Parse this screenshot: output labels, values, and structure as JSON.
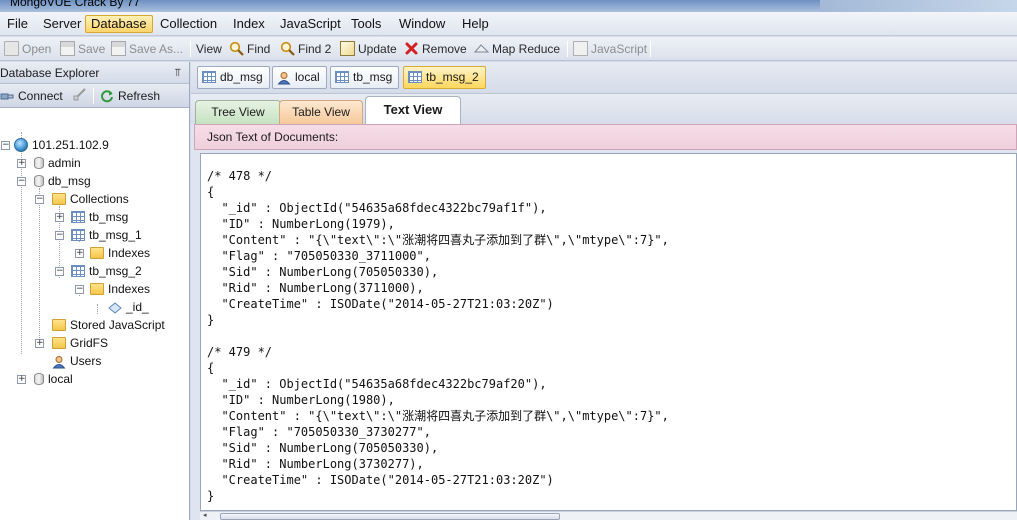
{
  "window": {
    "title": "MongoVUE Crack By 77"
  },
  "menu": [
    "File",
    "Server",
    "Database",
    "Collection",
    "Index",
    "JavaScript",
    "Tools",
    "Window",
    "Help"
  ],
  "menu_active": "Database",
  "toolbar": {
    "open": "Open",
    "save": "Save",
    "save_as": "Save As...",
    "view": "View",
    "find": "Find",
    "find2": "Find 2",
    "update": "Update",
    "remove": "Remove",
    "map_reduce": "Map Reduce",
    "javascript": "JavaScript"
  },
  "explorer": {
    "title": "Database Explorer",
    "pin": "⫪",
    "connect": "Connect",
    "refresh": "Refresh",
    "tree": {
      "server": "101.251.102.9",
      "admin": "admin",
      "db_msg": "db_msg",
      "collections": "Collections",
      "tb_msg": "tb_msg",
      "tb_msg_1": "tb_msg_1",
      "indexes_1": "Indexes",
      "tb_msg_2": "tb_msg_2",
      "indexes_2": "Indexes",
      "id_index": "_id_",
      "stored_js": "Stored JavaScript",
      "gridfs": "GridFS",
      "users": "Users",
      "local": "local"
    }
  },
  "doc_tabs": [
    "db_msg",
    "local",
    "tb_msg",
    "tb_msg_2"
  ],
  "view_tabs": {
    "tree": "Tree View",
    "table": "Table View",
    "text": "Text View"
  },
  "json_label": "Json Text of Documents:",
  "code_lines": [
    "/* 478 */",
    "{",
    "  \"_id\" : ObjectId(\"54635a68fdec4322bc79af1f\"),",
    "  \"ID\" : NumberLong(1979),",
    "  \"Content\" : \"{\\\"text\\\":\\\"涨潮将四喜丸子添加到了群\\\",\\\"mtype\\\":7}\",",
    "  \"Flag\" : \"705050330_3711000\",",
    "  \"Sid\" : NumberLong(705050330),",
    "  \"Rid\" : NumberLong(3711000),",
    "  \"CreateTime\" : ISODate(\"2014-05-27T21:03:20Z\")",
    "}",
    "",
    "/* 479 */",
    "{",
    "  \"_id\" : ObjectId(\"54635a68fdec4322bc79af20\"),",
    "  \"ID\" : NumberLong(1980),",
    "  \"Content\" : \"{\\\"text\\\":\\\"涨潮将四喜丸子添加到了群\\\",\\\"mtype\\\":7}\",",
    "  \"Flag\" : \"705050330_3730277\",",
    "  \"Sid\" : NumberLong(705050330),",
    "  \"Rid\" : NumberLong(3730277),",
    "  \"CreateTime\" : ISODate(\"2014-05-27T21:03:20Z\")",
    "}"
  ]
}
